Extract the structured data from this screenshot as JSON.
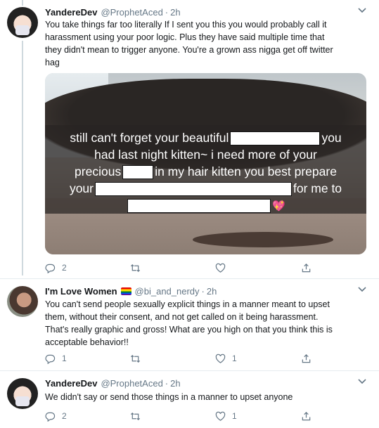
{
  "tweets": [
    {
      "name": "YandereDev",
      "handle": "@ProphetAced",
      "time": "2h",
      "text_lines": [
        "You take things far too literally If I sent you this you would probably call it",
        "harassment using your poor logic. Plus they have said multiple time that",
        "they didn't mean to trigger anyone. You're a grown ass nigga get off twitter",
        "hag"
      ],
      "image_caption": {
        "line1_a": "still can't forget your beautiful",
        "line1_b": "you",
        "line2": "had last night kitten~ i need more of your",
        "line3_a": "precious",
        "line3_b": "in my hair kitten you best prepare",
        "line4_a": "your",
        "line4_b": "for me to"
      },
      "replies": "2",
      "retweets": "",
      "likes": ""
    },
    {
      "name": "I'm Love Women",
      "handle": "@bi_and_nerdy",
      "time": "2h",
      "text_lines": [
        "You can't send people sexually explicit things in a manner meant to upset",
        "them, without their consent, and not get called on it being harassment.",
        "That's really graphic and gross! What are you high on that you think this is",
        "acceptable behavior!!"
      ],
      "replies": "1",
      "retweets": "",
      "likes": "1"
    },
    {
      "name": "YandereDev",
      "handle": "@ProphetAced",
      "time": "2h",
      "text_lines": [
        "We didn't say or send those things in a manner to upset anyone"
      ],
      "replies": "2",
      "retweets": "",
      "likes": "1"
    }
  ],
  "dot_separator": "·",
  "icons": [
    "reply-icon",
    "retweet-icon",
    "like-icon",
    "share-icon",
    "chevron-down-icon"
  ],
  "colors": {
    "text": "#14171a",
    "muted": "#657786",
    "divider": "#e6ecf0",
    "thread": "#cfd9de"
  }
}
